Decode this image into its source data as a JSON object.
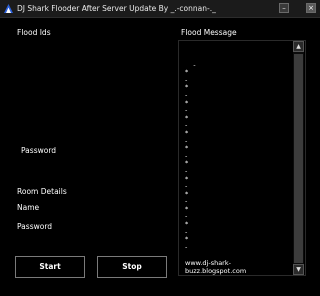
{
  "window": {
    "title": "DJ Shark Flooder After Server Update By _.-connan-._",
    "minimize_symbol": "–",
    "close_symbol": "×"
  },
  "labels": {
    "flood_ids": "Flood Ids",
    "flood_message": "Flood Message",
    "password_1": "Password",
    "room_details": "Room Details",
    "name": "Name",
    "password_2": "Password"
  },
  "message_box": {
    "content": "-\n*\n-\n*\n-\n*\n-\n*\n-\n*\n-\n*\n-\n*\n-\n*\n-\n*\n-\n*\n-\n*\n-\n*\n-",
    "url": "www.dj-shark-buzz.blogspot.com",
    "scroll_up": "▲",
    "scroll_down": "▼"
  },
  "buttons": {
    "start": "Start",
    "stop": "Stop"
  },
  "colors": {
    "background": "#000000",
    "titlebar": "#1b1b1b",
    "text": "#ffffff",
    "button_border": "#7a7a7a"
  },
  "icons": {
    "app": "shark-app-icon",
    "minimize": "minimize-icon",
    "close": "close-icon"
  }
}
